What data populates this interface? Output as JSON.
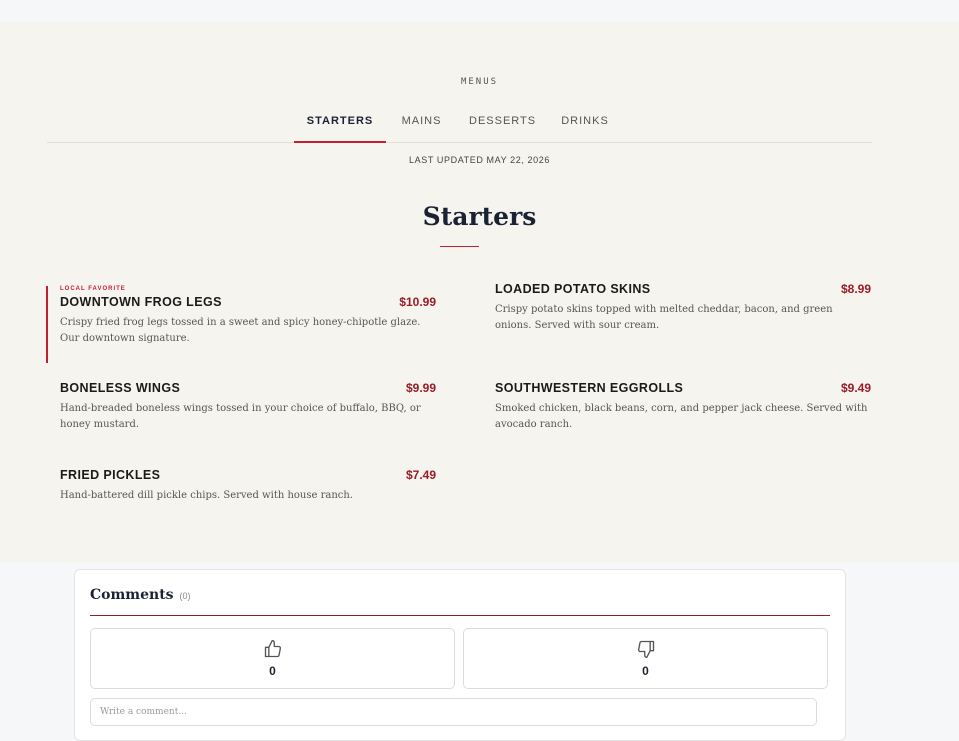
{
  "menu": {
    "eyebrow": "MENUS",
    "tabs": [
      "STARTERS",
      "MAINS",
      "DESSERTS",
      "DRINKS"
    ],
    "active_tab": "STARTERS",
    "last_updated": "LAST UPDATED MAY 22, 2026",
    "section_title": "Starters",
    "items": [
      {
        "badge": "LOCAL FAVORITE",
        "name": "DOWNTOWN FROG LEGS",
        "price": "$10.99",
        "description": "Crispy fried frog legs tossed in a sweet and spicy honey-chipotle glaze. Our downtown signature."
      },
      {
        "name": "LOADED POTATO SKINS",
        "price": "$8.99",
        "description": "Crispy potato skins topped with melted cheddar, bacon, and green onions. Served with sour cream."
      },
      {
        "name": "BONELESS WINGS",
        "price": "$9.99",
        "description": "Hand-breaded boneless wings tossed in your choice of buffalo, BBQ, or honey mustard."
      },
      {
        "name": "SOUTHWESTERN EGGROLLS",
        "price": "$9.49",
        "description": "Smoked chicken, black beans, corn, and pepper jack cheese. Served with avocado ranch."
      },
      {
        "name": "FRIED PICKLES",
        "price": "$7.49",
        "description": "Hand-battered dill pickle chips. Served with house ranch."
      }
    ]
  },
  "comments": {
    "title": "Comments",
    "count": "(0)",
    "likes": "0",
    "dislikes": "0",
    "placeholder": "Write a comment...",
    "like_icon": "thumbs-up-icon",
    "dislike_icon": "thumbs-down-icon"
  },
  "colors": {
    "accent": "#c21f33",
    "price": "#9a1b25",
    "navy": "#1a2234",
    "section_bg": "#f6f4ef"
  }
}
